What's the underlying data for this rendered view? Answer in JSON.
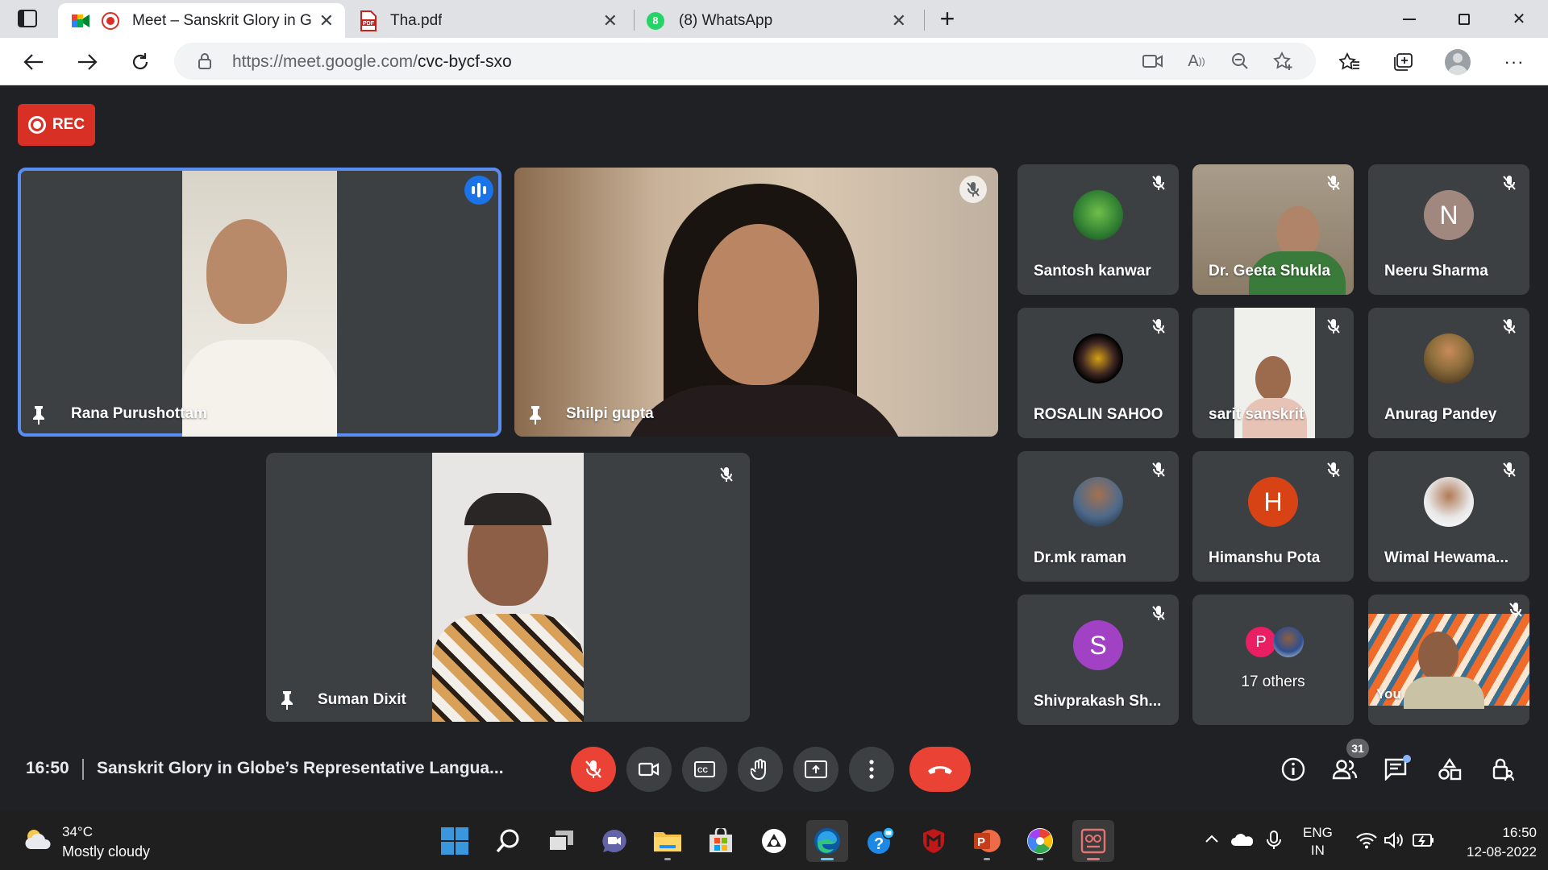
{
  "browser": {
    "tabs": [
      {
        "title": "Meet – Sanskrit Glory in Glo",
        "active": true
      },
      {
        "title": "Tha.pdf",
        "active": false
      },
      {
        "title": "(8) WhatsApp",
        "active": false
      }
    ],
    "url_host": "https://meet.google.com/",
    "url_path": "cvc-bycf-sxo"
  },
  "meet": {
    "rec_label": "REC",
    "main_tiles": [
      {
        "name": "Rana Purushottam",
        "speaking": true
      },
      {
        "name": "Shilpi gupta",
        "muted": true
      },
      {
        "name": "Suman Dixit",
        "muted": true
      }
    ],
    "grid": [
      {
        "name": "Santosh kanwar",
        "avatar": "photo"
      },
      {
        "name": "Dr. Geeta Shukla",
        "avatar": "video"
      },
      {
        "name": "Neeru Sharma",
        "avatar_letter": "N",
        "color": "#a1887f"
      },
      {
        "name": "ROSALIN SAHOO",
        "avatar": "om-logo"
      },
      {
        "name": "sarit sanskrit",
        "avatar": "video"
      },
      {
        "name": "Anurag Pandey",
        "avatar": "photo"
      },
      {
        "name": "Dr.mk raman",
        "avatar": "photo"
      },
      {
        "name": "Himanshu Pota",
        "avatar_letter": "H",
        "color": "#d84315"
      },
      {
        "name": "Wimal Hewama...",
        "avatar": "photo"
      },
      {
        "name": "Shivprakash Sh...",
        "avatar_letter": "S",
        "color": "#a142c4"
      },
      {
        "name": "17 others",
        "avatar_letter": "P",
        "color": "#e91e63"
      },
      {
        "name": "You",
        "avatar": "video"
      }
    ],
    "time": "16:50",
    "title": "Sanskrit Glory in Globe’s Representative Langua...",
    "participants_count": "31"
  },
  "taskbar": {
    "weather_temp": "34°C",
    "weather_desc": "Mostly cloudy",
    "lang_1": "ENG",
    "lang_2": "IN",
    "time": "16:50",
    "date": "12-08-2022"
  }
}
